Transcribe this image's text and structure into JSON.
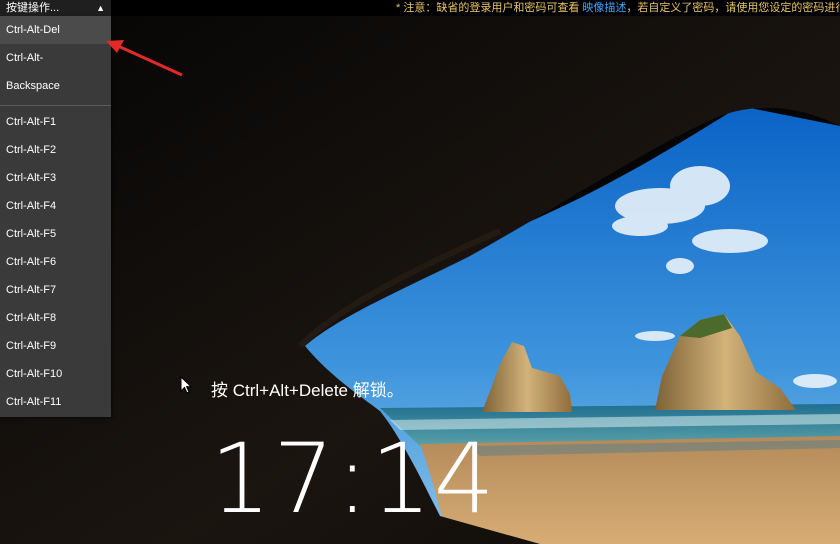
{
  "toolbar": {
    "dropdown_label": "按键操作...",
    "dropdown_caret": "▲",
    "notice_prefix": "* 注意：缺省的登录用户和密码可查看",
    "notice_link": "映像描述",
    "notice_suffix": "，若自定义了密码，请使用您设定的密码进行登"
  },
  "menu": {
    "items": [
      {
        "label": "Ctrl-Alt-Del"
      },
      {
        "label": "Ctrl-Alt-"
      },
      {
        "label": "Backspace"
      },
      {
        "label": "Ctrl-Alt-F1"
      },
      {
        "label": "Ctrl-Alt-F2"
      },
      {
        "label": "Ctrl-Alt-F3"
      },
      {
        "label": "Ctrl-Alt-F4"
      },
      {
        "label": "Ctrl-Alt-F5"
      },
      {
        "label": "Ctrl-Alt-F6"
      },
      {
        "label": "Ctrl-Alt-F7"
      },
      {
        "label": "Ctrl-Alt-F8"
      },
      {
        "label": "Ctrl-Alt-F9"
      },
      {
        "label": "Ctrl-Alt-F10"
      },
      {
        "label": "Ctrl-Alt-F11"
      }
    ]
  },
  "lockscreen": {
    "unlock_hint": "按 Ctrl+Alt+Delete 解锁。",
    "time": "17:14"
  },
  "colors": {
    "notice": "#e9c56a",
    "link": "#3fa6ff",
    "annotation_arrow": "#e02a2a"
  }
}
